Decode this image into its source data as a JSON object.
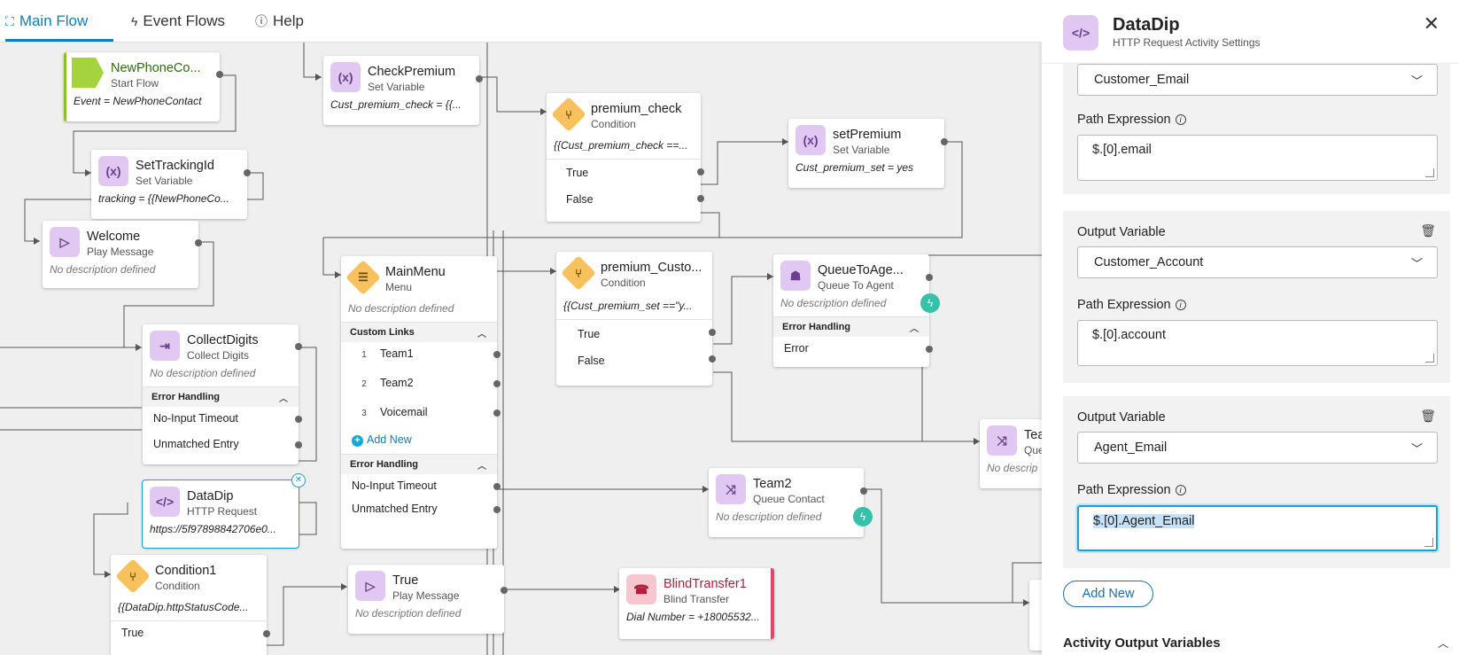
{
  "tabs": [
    {
      "label": "Main Flow",
      "icon": "flow-icon"
    },
    {
      "label": "Event Flows",
      "icon": "bolt-icon"
    },
    {
      "label": "Help",
      "icon": "help-icon"
    }
  ],
  "nodes": {
    "start": {
      "title": "NewPhoneCo...",
      "type": "Start Flow",
      "desc": "Event = NewPhoneContact"
    },
    "tracking": {
      "title": "SetTrackingId",
      "type": "Set Variable",
      "desc": "tracking = {{NewPhoneCo..."
    },
    "welcome": {
      "title": "Welcome",
      "type": "Play Message",
      "desc": "No description defined"
    },
    "collect": {
      "title": "CollectDigits",
      "type": "Collect Digits",
      "desc": "No description defined",
      "section": "Error Handling",
      "rows": [
        "No-Input Timeout",
        "Unmatched Entry"
      ]
    },
    "datadip": {
      "title": "DataDip",
      "type": "HTTP Request",
      "desc": "https://5f97898842706e0..."
    },
    "condition1": {
      "title": "Condition1",
      "type": "Condition",
      "desc": "{{DataDip.httpStatusCode...",
      "rows": [
        "True"
      ]
    },
    "checkpremium": {
      "title": "CheckPremium",
      "type": "Set Variable",
      "desc": "Cust_premium_check = {{..."
    },
    "mainmenu": {
      "title": "MainMenu",
      "type": "Menu",
      "desc": "No description defined",
      "section1": "Custom Links",
      "links": [
        {
          "n": "1",
          "label": "Team1"
        },
        {
          "n": "2",
          "label": "Team2"
        },
        {
          "n": "3",
          "label": "Voicemail"
        }
      ],
      "add_new": "Add New",
      "section2": "Error Handling",
      "rows": [
        "No-Input Timeout",
        "Unmatched Entry"
      ]
    },
    "trueplay": {
      "title": "True",
      "type": "Play Message",
      "desc": "No description defined"
    },
    "premiumcheck": {
      "title": "premium_check",
      "type": "Condition",
      "desc": "{{Cust_premium_check ==...",
      "rows": [
        "True",
        "False"
      ]
    },
    "premiumcusto": {
      "title": "premium_Custo...",
      "type": "Condition",
      "desc": "{{Cust_premium_set ==\"y...",
      "rows": [
        "True",
        "False"
      ]
    },
    "setpremium": {
      "title": "setPremium",
      "type": "Set Variable",
      "desc": "Cust_premium_set = yes"
    },
    "queuetoagent": {
      "title": "QueueToAge...",
      "type": "Queue To Agent",
      "desc": "No description defined",
      "section": "Error Handling",
      "rows": [
        "Error"
      ]
    },
    "team2": {
      "title": "Team2",
      "type": "Queue Contact",
      "desc": "No description defined"
    },
    "blind": {
      "title": "BlindTransfer1",
      "type": "Blind Transfer",
      "desc": "Dial Number = +18005532..."
    },
    "teamcut": {
      "title": "Tea",
      "type": "Que",
      "desc": "No descrip"
    }
  },
  "panel": {
    "title": "DataDip",
    "subtitle": "HTTP Request Activity Settings",
    "first_select": "Customer_Email",
    "first_path_label": "Path Expression",
    "first_path": "$.[0].email",
    "outputs": [
      {
        "label": "Output Variable",
        "value": "Customer_Account",
        "path_label": "Path Expression",
        "path": "$.[0].account"
      },
      {
        "label": "Output Variable",
        "value": "Agent_Email",
        "path_label": "Path Expression",
        "path": "$.[0].Agent_Email"
      }
    ],
    "add_new": "Add New",
    "section": "Activity Output Variables"
  },
  "colors": {
    "accent": "#0b7fb6",
    "condition": "#f7c15d",
    "variable": "#e0c8f2",
    "start": "#a4d33d",
    "bolt": "#35c2a8",
    "blind": "#f6c7cf"
  }
}
